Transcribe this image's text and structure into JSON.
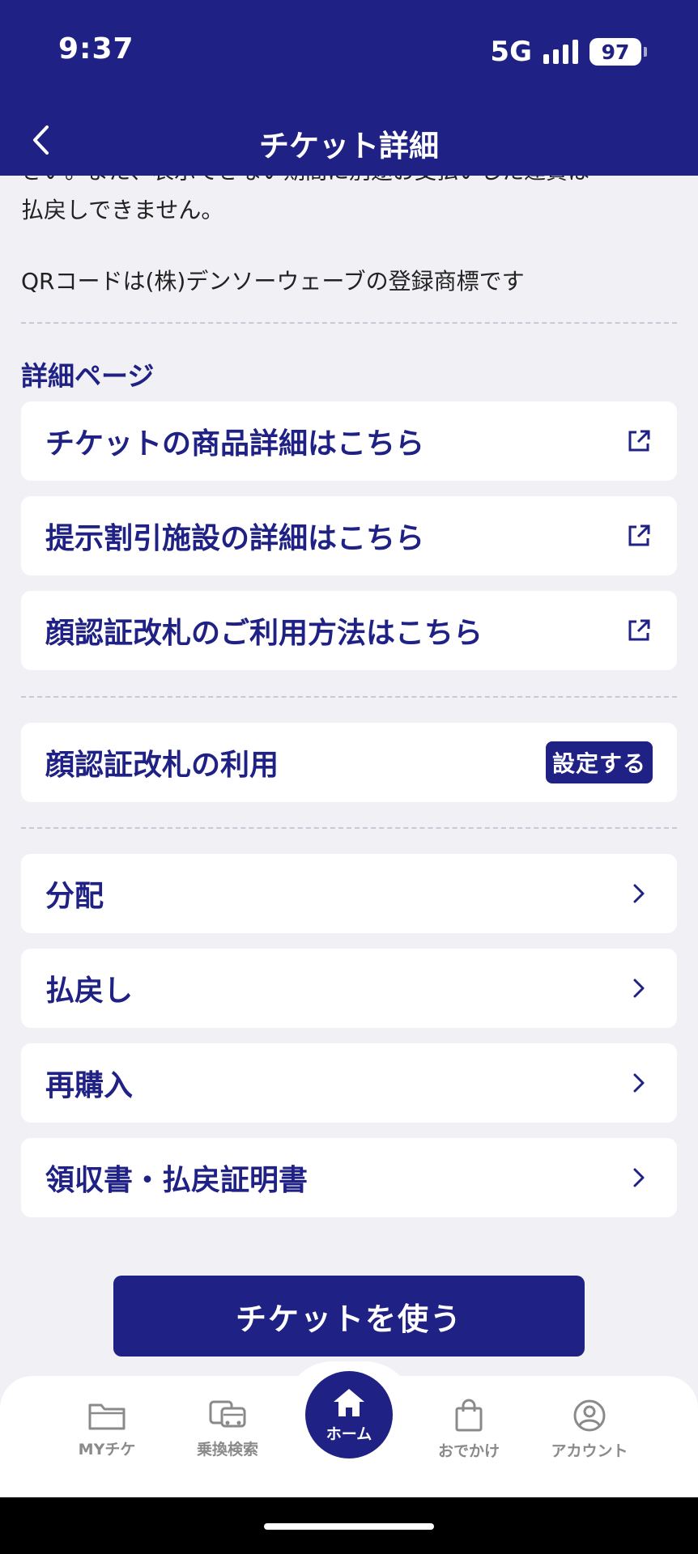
{
  "status_bar": {
    "time": "9:37",
    "network": "5G",
    "battery": "97"
  },
  "header": {
    "title": "チケット詳細"
  },
  "notes": {
    "cut_line": "さい。また、表示できない期間に別途お支払いした運賃は",
    "line1": "払戻しできません。",
    "qr_trademark": "QRコードは(株)デンソーウェーブの登録商標です"
  },
  "detail_section": {
    "title": "詳細ページ",
    "links": [
      {
        "label": "チケットの商品詳細はこちら"
      },
      {
        "label": "提示割引施設の詳細はこちら"
      },
      {
        "label": "顔認証改札のご利用方法はこちら"
      }
    ]
  },
  "face_auth": {
    "label": "顔認証改札の利用",
    "button": "設定する"
  },
  "menu_items": [
    {
      "label": "分配"
    },
    {
      "label": "払戻し"
    },
    {
      "label": "再購入"
    },
    {
      "label": "領収書・払戻証明書"
    }
  ],
  "use_button": "チケットを使う",
  "tabs": {
    "my": "MYチケ",
    "search": "乗換検索",
    "home": "ホーム",
    "outing": "おでかけ",
    "account": "アカウント"
  },
  "colors": {
    "primary": "#1f2185",
    "background": "#f0f0f5"
  },
  "icons": [
    "chevron-left-icon",
    "external-link-icon",
    "chevron-right-icon",
    "folder-icon",
    "transit-icon",
    "home-icon",
    "shopping-bag-icon",
    "account-icon"
  ]
}
